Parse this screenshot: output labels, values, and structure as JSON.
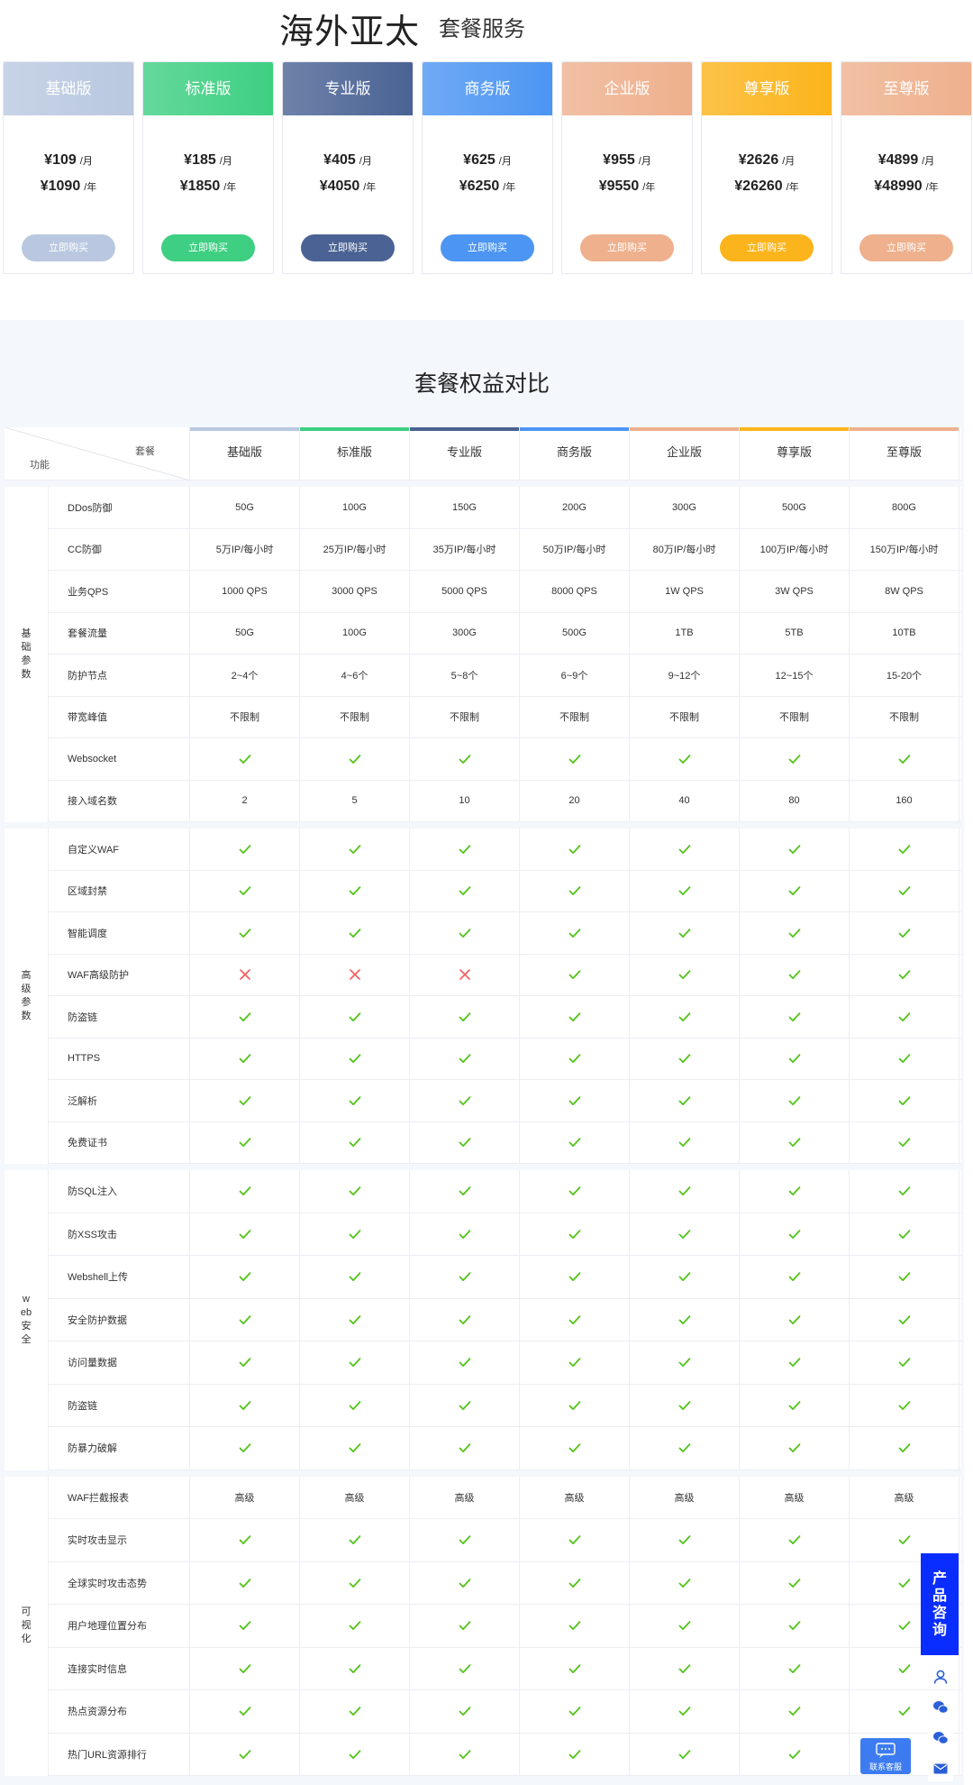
{
  "header": {
    "title_main": "海外亚太",
    "title_sub": "套餐服务"
  },
  "plans": [
    {
      "name": "基础版",
      "monthly": "¥109",
      "yearly": "¥1090",
      "per_month": "/月",
      "per_year": "/年",
      "buy_label": "立即购买",
      "color": "#b9c8e0"
    },
    {
      "name": "标准版",
      "monthly": "¥185",
      "yearly": "¥1850",
      "per_month": "/月",
      "per_year": "/年",
      "buy_label": "立即购买",
      "color": "#3ecf82"
    },
    {
      "name": "专业版",
      "monthly": "¥405",
      "yearly": "¥4050",
      "per_month": "/月",
      "per_year": "/年",
      "buy_label": "立即购买",
      "color": "#4a6394"
    },
    {
      "name": "商务版",
      "monthly": "¥625",
      "yearly": "¥6250",
      "per_month": "/月",
      "per_year": "/年",
      "buy_label": "立即购买",
      "color": "#4c95f3"
    },
    {
      "name": "企业版",
      "monthly": "¥955",
      "yearly": "¥9550",
      "per_month": "/月",
      "per_year": "/年",
      "buy_label": "立即购买",
      "color": "#eeb08d"
    },
    {
      "name": "尊享版",
      "monthly": "¥2626",
      "yearly": "¥26260",
      "per_month": "/月",
      "per_year": "/年",
      "buy_label": "立即购买",
      "color": "#fbb41b"
    },
    {
      "name": "至尊版",
      "monthly": "¥4899",
      "yearly": "¥48990",
      "per_month": "/月",
      "per_year": "/年",
      "buy_label": "立即购买",
      "color": "#eeb08d"
    }
  ],
  "comparison": {
    "title": "套餐权益对比",
    "corner_top": "套餐",
    "corner_bottom": "功能",
    "groups": [
      {
        "label": "基础参数",
        "rows": [
          {
            "feature": "DDos防御",
            "values": [
              "50G",
              "100G",
              "150G",
              "200G",
              "300G",
              "500G",
              "800G"
            ]
          },
          {
            "feature": "CC防御",
            "values": [
              "5万IP/每小时",
              "25万IP/每小时",
              "35万IP/每小时",
              "50万IP/每小时",
              "80万IP/每小时",
              "100万IP/每小时",
              "150万IP/每小时"
            ]
          },
          {
            "feature": "业务QPS",
            "values": [
              "1000 QPS",
              "3000 QPS",
              "5000 QPS",
              "8000 QPS",
              "1W QPS",
              "3W QPS",
              "8W QPS"
            ]
          },
          {
            "feature": "套餐流量",
            "values": [
              "50G",
              "100G",
              "300G",
              "500G",
              "1TB",
              "5TB",
              "10TB"
            ]
          },
          {
            "feature": "防护节点",
            "values": [
              "2~4个",
              "4~6个",
              "5~8个",
              "6~9个",
              "9~12个",
              "12~15个",
              "15-20个"
            ]
          },
          {
            "feature": "带宽峰值",
            "values": [
              "不限制",
              "不限制",
              "不限制",
              "不限制",
              "不限制",
              "不限制",
              "不限制"
            ]
          },
          {
            "feature": "Websocket",
            "values": [
              "check",
              "check",
              "check",
              "check",
              "check",
              "check",
              "check"
            ]
          },
          {
            "feature": "接入域名数",
            "values": [
              "2",
              "5",
              "10",
              "20",
              "40",
              "80",
              "160"
            ]
          }
        ]
      },
      {
        "label": "高级参数",
        "rows": [
          {
            "feature": "自定义WAF",
            "values": [
              "check",
              "check",
              "check",
              "check",
              "check",
              "check",
              "check"
            ]
          },
          {
            "feature": "区域封禁",
            "values": [
              "check",
              "check",
              "check",
              "check",
              "check",
              "check",
              "check"
            ]
          },
          {
            "feature": "智能调度",
            "values": [
              "check",
              "check",
              "check",
              "check",
              "check",
              "check",
              "check"
            ]
          },
          {
            "feature": "WAF高级防护",
            "values": [
              "cross",
              "cross",
              "cross",
              "check",
              "check",
              "check",
              "check"
            ]
          },
          {
            "feature": "防盗链",
            "values": [
              "check",
              "check",
              "check",
              "check",
              "check",
              "check",
              "check"
            ]
          },
          {
            "feature": "HTTPS",
            "values": [
              "check",
              "check",
              "check",
              "check",
              "check",
              "check",
              "check"
            ]
          },
          {
            "feature": "泛解析",
            "values": [
              "check",
              "check",
              "check",
              "check",
              "check",
              "check",
              "check"
            ]
          },
          {
            "feature": "免费证书",
            "values": [
              "check",
              "check",
              "check",
              "check",
              "check",
              "check",
              "check"
            ]
          }
        ]
      },
      {
        "label": "web安全",
        "rows": [
          {
            "feature": "防SQL注入",
            "values": [
              "check",
              "check",
              "check",
              "check",
              "check",
              "check",
              "check"
            ]
          },
          {
            "feature": "防XSS攻击",
            "values": [
              "check",
              "check",
              "check",
              "check",
              "check",
              "check",
              "check"
            ]
          },
          {
            "feature": "Webshell上传",
            "values": [
              "check",
              "check",
              "check",
              "check",
              "check",
              "check",
              "check"
            ]
          },
          {
            "feature": "安全防护数据",
            "values": [
              "check",
              "check",
              "check",
              "check",
              "check",
              "check",
              "check"
            ]
          },
          {
            "feature": "访问量数据",
            "values": [
              "check",
              "check",
              "check",
              "check",
              "check",
              "check",
              "check"
            ]
          },
          {
            "feature": "防盗链",
            "values": [
              "check",
              "check",
              "check",
              "check",
              "check",
              "check",
              "check"
            ]
          },
          {
            "feature": "防暴力破解",
            "values": [
              "check",
              "check",
              "check",
              "check",
              "check",
              "check",
              "check"
            ]
          }
        ]
      },
      {
        "label": "可视化",
        "rows": [
          {
            "feature": "WAF拦截报表",
            "values": [
              "高级",
              "高级",
              "高级",
              "高级",
              "高级",
              "高级",
              "高级"
            ]
          },
          {
            "feature": "实时攻击显示",
            "values": [
              "check",
              "check",
              "check",
              "check",
              "check",
              "check",
              "check"
            ]
          },
          {
            "feature": "全球实时攻击态势",
            "values": [
              "check",
              "check",
              "check",
              "check",
              "check",
              "check",
              "check"
            ]
          },
          {
            "feature": "用户地理位置分布",
            "values": [
              "check",
              "check",
              "check",
              "check",
              "check",
              "check",
              "check"
            ]
          },
          {
            "feature": "连接实时信息",
            "values": [
              "check",
              "check",
              "check",
              "check",
              "check",
              "check",
              "check"
            ]
          },
          {
            "feature": "热点资源分布",
            "values": [
              "check",
              "check",
              "check",
              "check",
              "check",
              "check",
              "check"
            ]
          },
          {
            "feature": "热门URL资源排行",
            "values": [
              "check",
              "check",
              "check",
              "check",
              "check",
              "check",
              "check"
            ]
          }
        ]
      }
    ]
  },
  "floating": {
    "consult_label": "产品咨询",
    "contact_label": "联系客服",
    "side_icons": [
      "user-icon",
      "wechat-icon",
      "wechat-icon",
      "mail-icon"
    ]
  },
  "colors": {
    "check": "#52c41a",
    "cross": "#f25c5c",
    "consult_bg": "#0a2dff"
  }
}
